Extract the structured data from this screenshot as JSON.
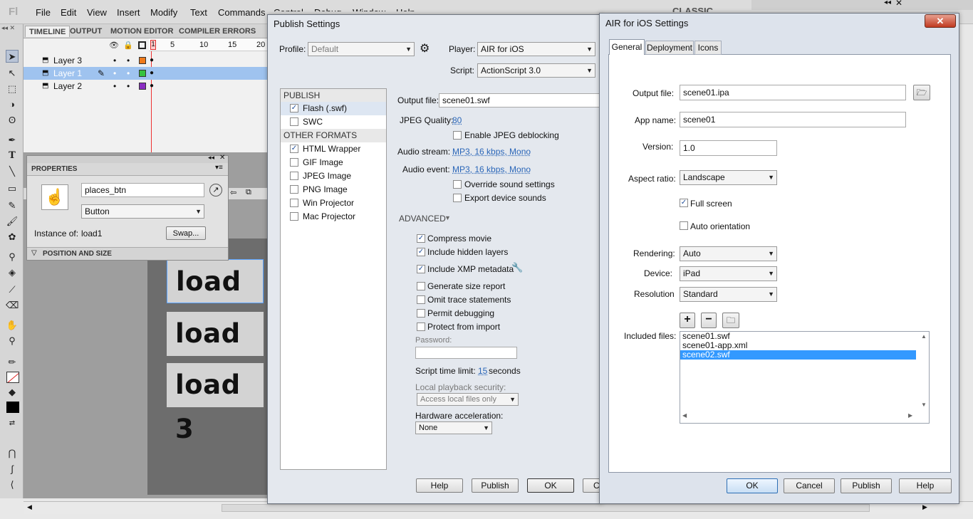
{
  "app": {
    "logo": "Fl",
    "menu": [
      "File",
      "Edit",
      "View",
      "Insert",
      "Modify",
      "Text",
      "Commands",
      "Control",
      "Debug",
      "Window",
      "Help"
    ],
    "workspace": "CLASSIC"
  },
  "timeline": {
    "tabs": [
      "TIMELINE",
      "OUTPUT",
      "MOTION EDITOR",
      "COMPILER ERRORS"
    ],
    "frame_numbers": [
      "1",
      "5",
      "10",
      "15",
      "20"
    ],
    "layers": [
      {
        "name": "Layer 3",
        "color": "#f07a1a"
      },
      {
        "name": "Layer 1",
        "color": "#35c23f"
      },
      {
        "name": "Layer 2",
        "color": "#8a2ec2"
      }
    ]
  },
  "properties": {
    "title": "PROPERTIES",
    "instance_name": "places_btn",
    "type": "Button",
    "instance_of_label": "Instance of:",
    "instance_of": "load1",
    "swap": "Swap...",
    "section": "POSITION AND SIZE"
  },
  "stage": {
    "buttons": [
      "load 1",
      "load 2",
      "load 3"
    ]
  },
  "publish": {
    "title": "Publish Settings",
    "profile_label": "Profile:",
    "profile": "Default",
    "player_label": "Player:",
    "player": "AIR for iOS",
    "script_label": "Script:",
    "script": "ActionScript 3.0",
    "publish_header": "PUBLISH",
    "targets": [
      {
        "label": "Flash (.swf)",
        "checked": true
      },
      {
        "label": "SWC",
        "checked": false
      }
    ],
    "other_header": "OTHER FORMATS",
    "formats": [
      {
        "label": "HTML Wrapper",
        "checked": true
      },
      {
        "label": "GIF Image",
        "checked": false
      },
      {
        "label": "JPEG Image",
        "checked": false
      },
      {
        "label": "PNG Image",
        "checked": false
      },
      {
        "label": "Win Projector",
        "checked": false
      },
      {
        "label": "Mac Projector",
        "checked": false
      }
    ],
    "output_file_label": "Output file:",
    "output_file": "scene01.swf",
    "jpeg_quality_label": "JPEG Quality:",
    "jpeg_quality": "80",
    "deblocking": "Enable JPEG deblocking",
    "audio_stream_label": "Audio stream:",
    "audio_stream": "MP3, 16 kbps, Mono",
    "audio_event_label": "Audio event:",
    "audio_event": "MP3, 16 kbps, Mono",
    "override_sound": "Override sound settings",
    "export_device": "Export device sounds",
    "advanced": "ADVANCED",
    "advanced_opts": [
      {
        "label": "Compress movie",
        "checked": true
      },
      {
        "label": "Include hidden layers",
        "checked": true
      },
      {
        "label": "Include XMP metadata",
        "checked": true
      },
      {
        "label": "Generate size report",
        "checked": false
      },
      {
        "label": "Omit trace statements",
        "checked": false
      },
      {
        "label": "Permit debugging",
        "checked": false
      },
      {
        "label": "Protect from import",
        "checked": false
      }
    ],
    "password_label": "Password:",
    "script_time_label": "Script time limit:",
    "script_time": "15",
    "seconds": "seconds",
    "local_security_label": "Local playback security:",
    "local_security": "Access local files only",
    "hw_accel_label": "Hardware acceleration:",
    "hw_accel": "None",
    "buttons": {
      "help": "Help",
      "publish": "Publish",
      "ok": "OK",
      "cancel": "C"
    }
  },
  "air": {
    "title": "AIR for iOS Settings",
    "tabs": [
      "General",
      "Deployment",
      "Icons"
    ],
    "output_file_label": "Output file:",
    "output_file": "scene01.ipa",
    "app_name_label": "App name:",
    "app_name": "scene01",
    "version_label": "Version:",
    "version": "1.0",
    "aspect_label": "Aspect ratio:",
    "aspect": "Landscape",
    "full_screen": "Full screen",
    "full_screen_checked": true,
    "auto_orientation": "Auto orientation",
    "auto_orientation_checked": false,
    "rendering_label": "Rendering:",
    "rendering": "Auto",
    "device_label": "Device:",
    "device": "iPad",
    "resolution_label": "Resolution",
    "resolution": "Standard",
    "included_label": "Included files:",
    "files": [
      "scene01.swf",
      "scene01-app.xml",
      "scene02.swf"
    ],
    "selected_file": "scene02.swf",
    "buttons": {
      "ok": "OK",
      "cancel": "Cancel",
      "publish": "Publish",
      "help": "Help"
    }
  }
}
